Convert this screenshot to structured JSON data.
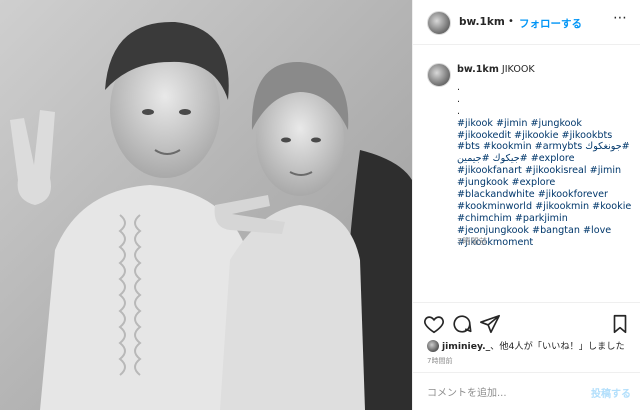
{
  "header": {
    "username": "bw.1km",
    "separator": "•",
    "follow_label": "フォローする",
    "more_icon": "more-horizontal-icon"
  },
  "caption": {
    "username": "bw.1km",
    "text": "JIKOOK",
    "dots": [
      ".",
      ".",
      "."
    ],
    "hashtags": [
      "#jikook",
      "#jimin",
      "#jungkook",
      "#jikookedit",
      "#jikookie",
      "#jikookbts",
      "#bts",
      "#kookmin",
      "#armybts",
      "#جونغكوك",
      "#جيمين",
      "#جيكوك",
      "#explore",
      "#jikookfanart",
      "#jikookisreal",
      "#jimin",
      "#jungkook",
      "#explore",
      "#blackandwhite",
      "#jikookforever",
      "#kookminworld",
      "#jikookmin",
      "#kookie",
      "#chimchim",
      "#parkjimin",
      "#jeonjungkook",
      "#bangtan",
      "#love",
      "#jikookmoment"
    ],
    "time": "7時間前"
  },
  "actions": {
    "icons": [
      "heart-icon",
      "comment-icon",
      "share-icon",
      "bookmark-icon"
    ]
  },
  "likes": {
    "user": "jiminiey._",
    "text": "、他4人が「いいね！」しました"
  },
  "post_time": "7時間前",
  "comment": {
    "placeholder": "コメントを追加...",
    "post_label": "投稿する"
  },
  "colors": {
    "accent": "#0095f6",
    "hashtag": "#00376b",
    "muted": "#8e8e8e",
    "post_disabled": "#b2dffc"
  }
}
